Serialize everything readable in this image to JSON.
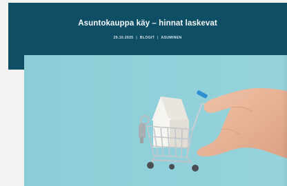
{
  "article": {
    "title": "Asuntokauppa käy – hinnat laskevat",
    "date": "29.10.2025",
    "category": "BLOGIT",
    "tag": "ASUMINEN",
    "separator": "|"
  },
  "hero_image": {
    "description_icon": "shopping-cart-with-house-icon"
  },
  "colors": {
    "header_bg": "#0f4f66",
    "hero_bg": "#8fcfd8",
    "page_bg": "#f3f3f2"
  }
}
